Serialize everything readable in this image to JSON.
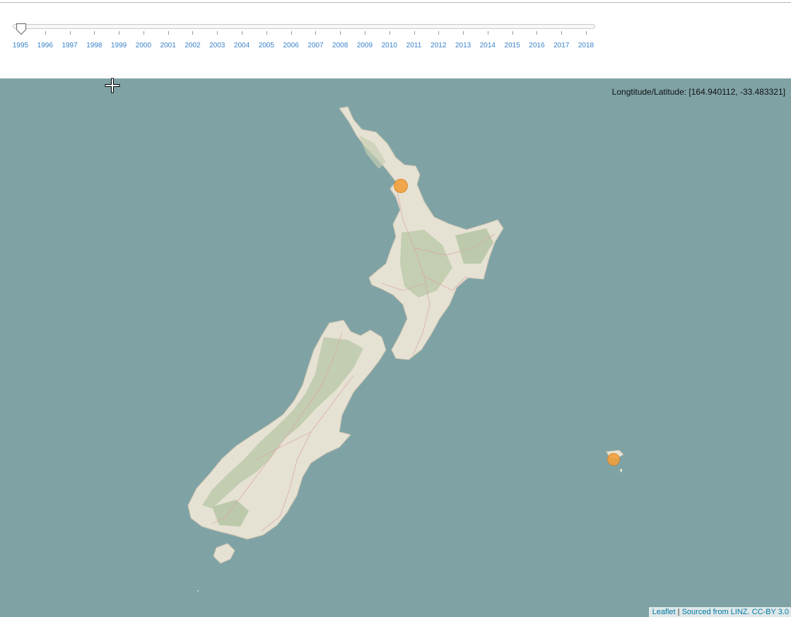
{
  "timeline": {
    "years": [
      "1995",
      "1996",
      "1997",
      "1998",
      "1999",
      "2000",
      "2001",
      "2002",
      "2003",
      "2004",
      "2005",
      "2006",
      "2007",
      "2008",
      "2009",
      "2010",
      "2011",
      "2012",
      "2013",
      "2014",
      "2015",
      "2016",
      "2017",
      "2018"
    ],
    "selected_year": "1995"
  },
  "map": {
    "coordinate_readout": "Longtitude/Latitude: [164.940112, -33.483321]",
    "water_color": "#7fa2a5",
    "land_color": "#e6e2d3",
    "marker_color": "#f2a03c",
    "attribution": {
      "leaflet_link": "Leaflet",
      "separator": " | ",
      "source_link": "Sourced from LINZ. CC-BY 3.0"
    },
    "markers": [
      {
        "name": "auckland-marker"
      },
      {
        "name": "chatham-islands-marker"
      }
    ]
  },
  "cursor": {
    "icon": "crosshair-cursor-icon"
  }
}
